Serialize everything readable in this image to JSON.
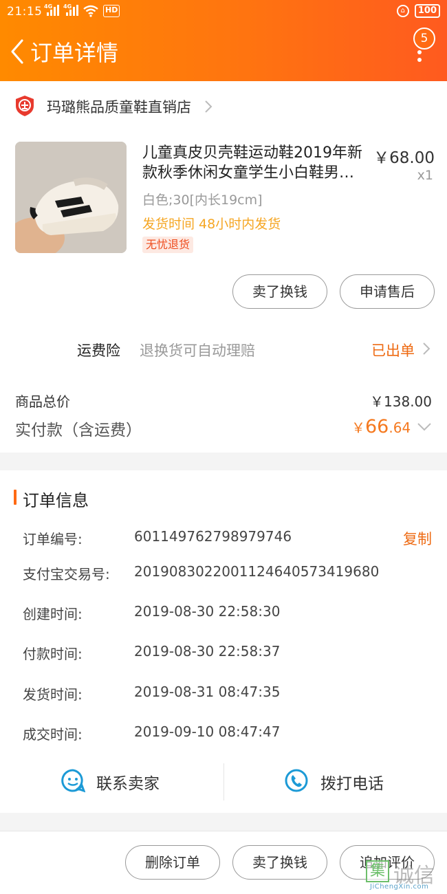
{
  "status_bar": {
    "time": "21:15",
    "network_1": "4G",
    "network_2": "4G",
    "hd": "HD",
    "battery": "100"
  },
  "header": {
    "title": "订单详情",
    "badge_count": "5",
    "back_icon": "chevron-left-icon",
    "more_icon": "vertical-ellipsis-icon"
  },
  "shop": {
    "name": "玛璐熊品质童鞋直销店",
    "logo_icon": "enterprise-shield-icon"
  },
  "product": {
    "title": "儿童真皮贝壳鞋运动鞋2019年新款秋季休闲女童学生小白鞋男…",
    "price": "￥68.00",
    "quantity": "x1",
    "sku": "白色;30[内长19cm]",
    "shipping_time": "发货时间 48小时内发货",
    "tag": "无忧退货"
  },
  "item_actions": {
    "sell_label": "卖了换钱",
    "after_sale_label": "申请售后"
  },
  "insurance": {
    "label": "运费险",
    "description": "退换货可自动理赔",
    "status": "已出单"
  },
  "summary": {
    "total_label": "商品总价",
    "total_value": "￥138.00",
    "paid_label": "实付款（含运费）",
    "paid_currency": "￥",
    "paid_integer": "66",
    "paid_decimal": ".64"
  },
  "order_info": {
    "section_title": "订单信息",
    "copy_label": "复制",
    "rows": [
      {
        "label": "订单编号:",
        "value": "601149762798979746"
      },
      {
        "label": "支付宝交易号:",
        "value": "2019083022001124640573419680"
      },
      {
        "label": "创建时间:",
        "value": "2019-08-30 22:58:30"
      },
      {
        "label": "付款时间:",
        "value": "2019-08-30 22:58:37"
      },
      {
        "label": "发货时间:",
        "value": "2019-08-31 08:47:35"
      },
      {
        "label": "成交时间:",
        "value": "2019-09-10 08:47:47"
      }
    ]
  },
  "contact": {
    "seller_label": "联系卖家",
    "call_label": "拨打电话"
  },
  "bottom_bar": {
    "delete_label": "删除订单",
    "sell_label": "卖了换钱",
    "review_label": "追加评价"
  },
  "watermark": {
    "glyph": "集",
    "text": "诚信",
    "url": "JiChengXin.com"
  },
  "colors": {
    "header_start": "#ff8a00",
    "header_end": "#ff5a1f",
    "accent": "#ee6a12",
    "ship_time": "#f5a623",
    "icon_blue": "#1c9ad6"
  }
}
